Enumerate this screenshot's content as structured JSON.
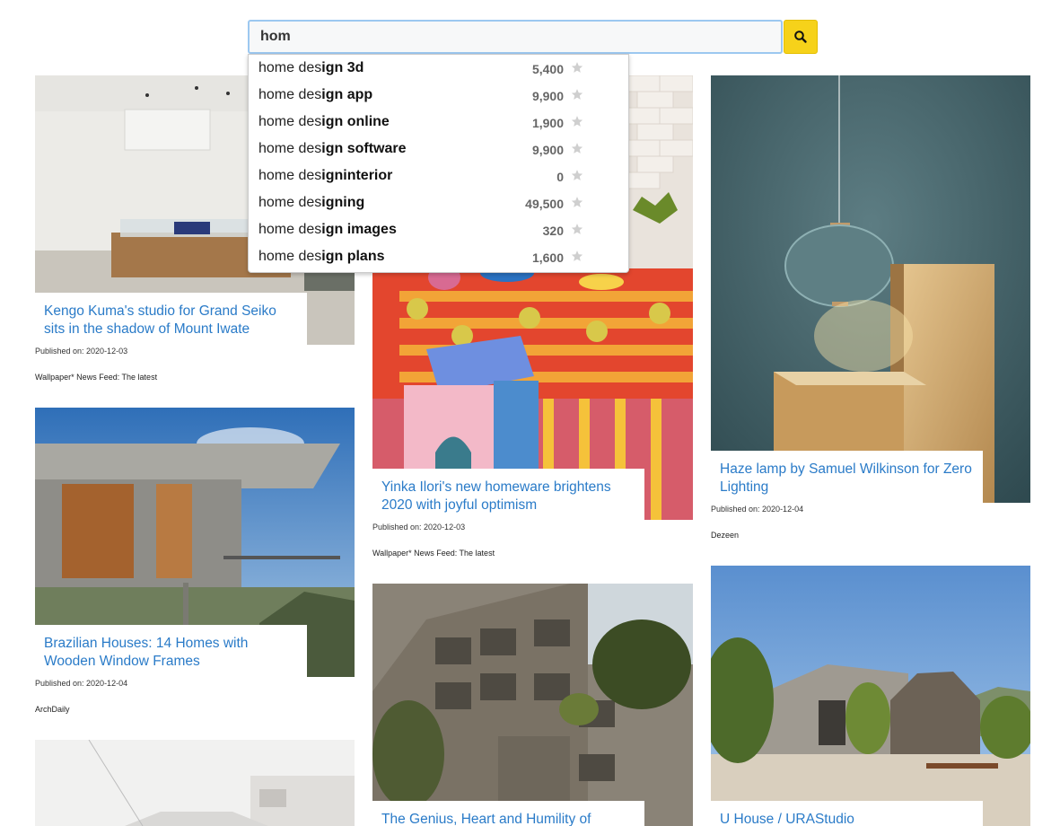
{
  "search": {
    "value": "hom",
    "button_icon": "search-icon",
    "button_color": "#f6d21a"
  },
  "suggestions": [
    {
      "prefix": "home des",
      "suffix": "ign 3d",
      "count": "5,400"
    },
    {
      "prefix": "home des",
      "suffix": "ign app",
      "count": "9,900"
    },
    {
      "prefix": "home des",
      "suffix": "ign online",
      "count": "1,900"
    },
    {
      "prefix": "home des",
      "suffix": "ign software",
      "count": "9,900"
    },
    {
      "prefix": "home des",
      "suffix": "igninterior",
      "count": "0"
    },
    {
      "prefix": "home des",
      "suffix": "igning",
      "count": "49,500"
    },
    {
      "prefix": "home des",
      "suffix": "ign images",
      "count": "320"
    },
    {
      "prefix": "home des",
      "suffix": "ign plans",
      "count": "1,600"
    }
  ],
  "articles": [
    {
      "title": "Kengo Kuma's studio for Grand Seiko sits in the shadow of Mount Iwate",
      "published": "Published on: 2020-12-03",
      "source": "Wallpaper* News Feed: The latest"
    },
    {
      "title": "Brazilian Houses: 14 Homes with Wooden Window Frames",
      "published": "Published on: 2020-12-04",
      "source": "ArchDaily"
    },
    {
      "title": "Yinka Ilori's new homeware brightens 2020 with joyful optimism",
      "published": "Published on: 2020-12-03",
      "source": "Wallpaper* News Feed: The latest"
    },
    {
      "title": "The Genius, Heart and Humility of",
      "published": "",
      "source": ""
    },
    {
      "title": "Haze lamp by Samuel Wilkinson for Zero Lighting",
      "published": "Published on: 2020-12-04",
      "source": "Dezeen"
    },
    {
      "title": "U House / URAStudio",
      "published": "",
      "source": ""
    }
  ],
  "colors": {
    "link": "#2a7bc8",
    "search_border": "#9cc8f0",
    "star": "#cfcfcf"
  }
}
